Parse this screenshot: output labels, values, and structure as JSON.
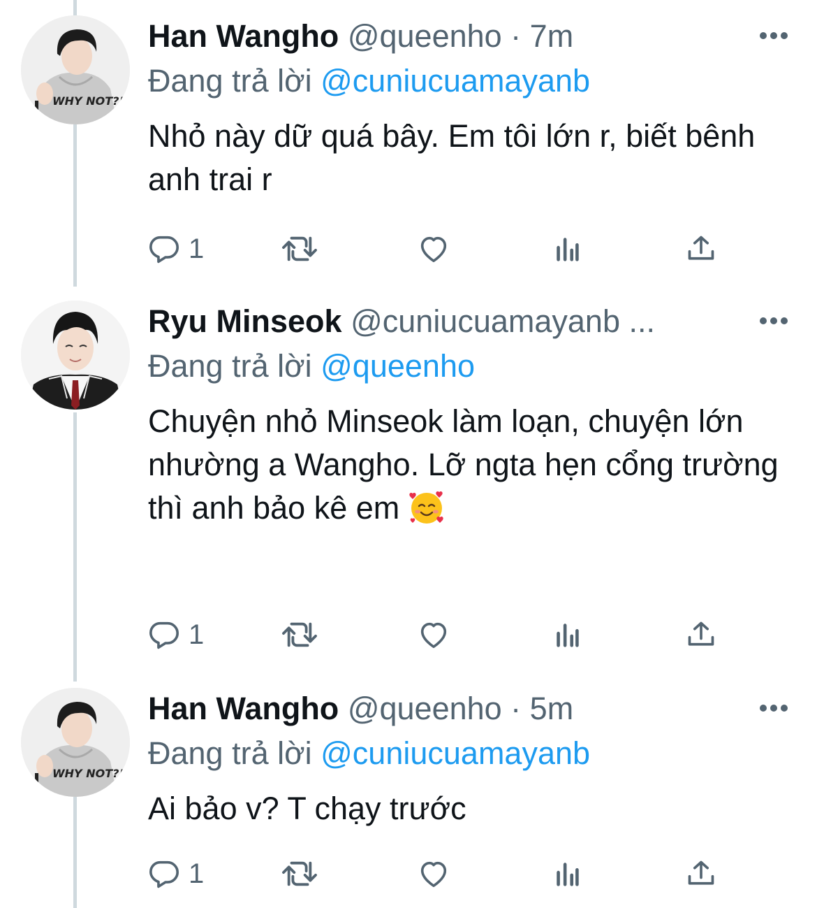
{
  "tweets": [
    {
      "name": "Han Wangho",
      "meta": "@queenho · 7m",
      "reply_prefix": "Đang trả lời",
      "reply_handle": "@cuniucuamayanb",
      "body": "Nhỏ này dữ quá bây. Em tôi lớn r, biết bênh anh trai r",
      "reply_count": "1",
      "avatar_shirt_text": "WHY NOT?!"
    },
    {
      "name": "Ryu Minseok",
      "meta": "@cuniucuamayanb ...",
      "reply_prefix": "Đang trả lời",
      "reply_handle": "@queenho",
      "body": "Chuyện nhỏ Minseok làm loạn, chuyện lớn nhường a Wangho. Lỡ ngta hẹn cổng trường thì anh bảo kê em",
      "reply_count": "1"
    },
    {
      "name": "Han Wangho",
      "meta": "@queenho · 5m",
      "reply_prefix": "Đang trả lời",
      "reply_handle": "@cuniucuamayanb",
      "body": "Ai bảo v? T chạy trước",
      "reply_count": "1",
      "avatar_shirt_text": "WHY NOT?!"
    }
  ],
  "icons": {
    "reply": "reply-icon",
    "retweet": "retweet-icon",
    "like": "like-icon",
    "views": "analytics-icon",
    "share": "share-icon",
    "more": "more-icon",
    "emoji": "smiling-face-with-hearts-emoji"
  },
  "colors": {
    "text": "#0f1419",
    "secondary": "#536471",
    "link": "#1d9bf0",
    "thread_line": "#cfd9de"
  }
}
